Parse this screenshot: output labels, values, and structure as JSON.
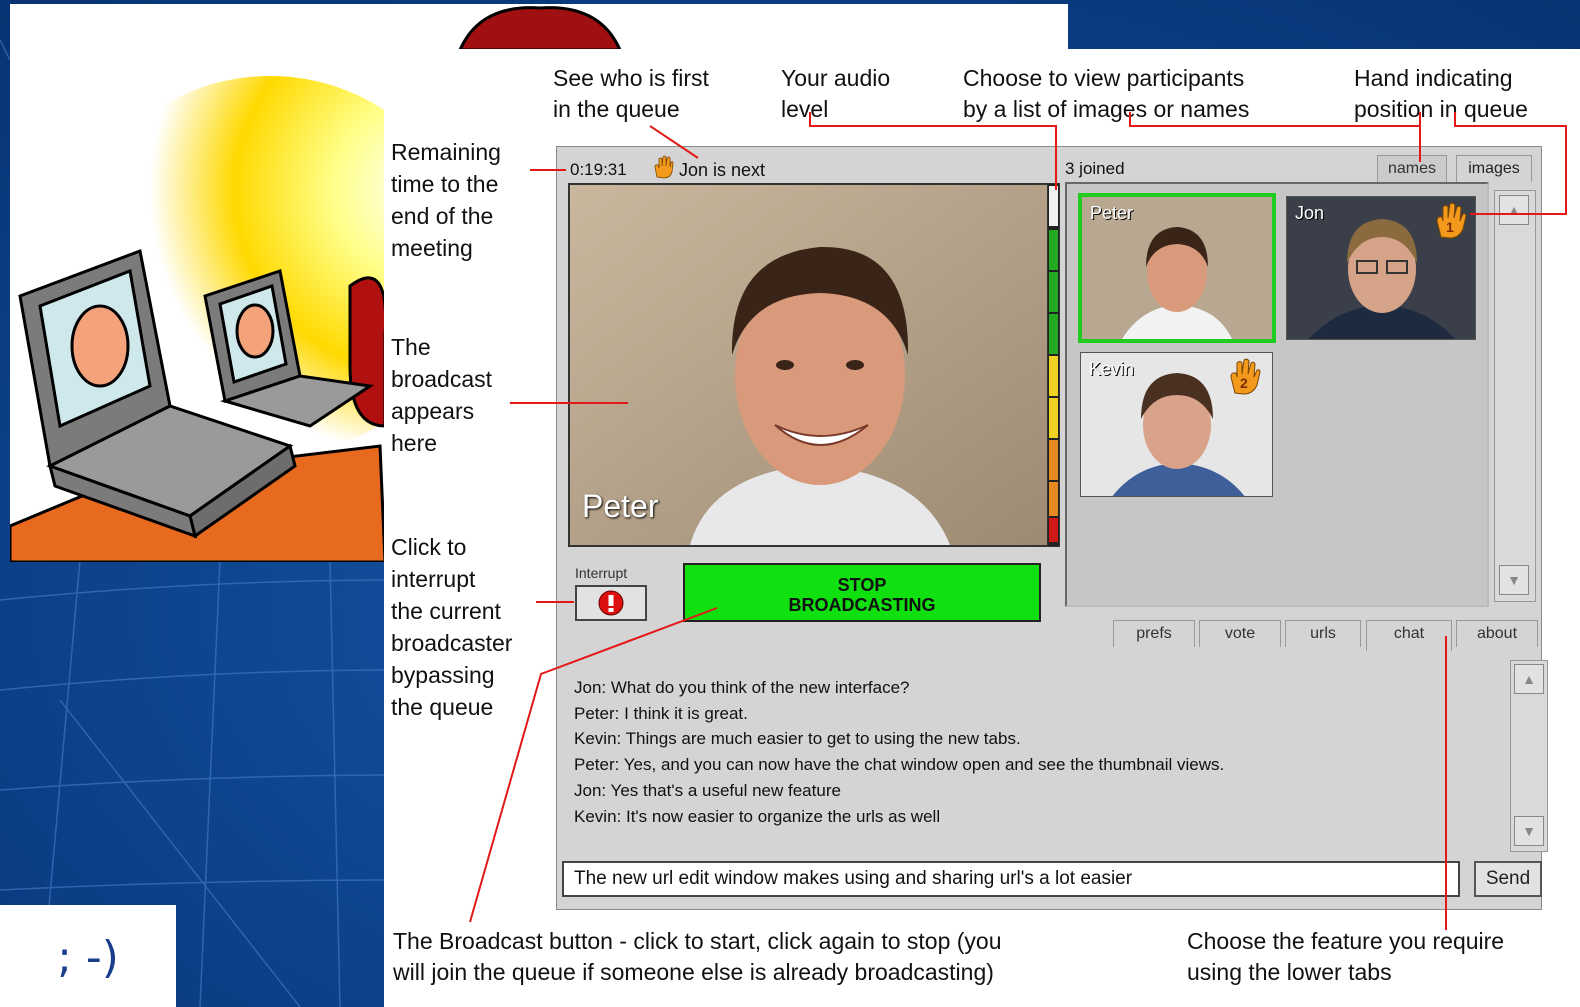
{
  "callouts": {
    "queue_first": [
      "See who is first",
      "in the queue"
    ],
    "audio_level": [
      "Your audio",
      "level"
    ],
    "view_participants": [
      "Choose to view participants",
      "by a list of images or names"
    ],
    "hand_indicating": [
      "Hand indicating",
      "position in queue"
    ],
    "remaining_time": [
      "Remaining",
      "time to the",
      "end of the",
      "meeting"
    ],
    "broadcast_appears": [
      "The",
      "broadcast",
      "appears",
      "here"
    ],
    "click_interrupt": [
      "Click to",
      "interrupt",
      "the current",
      "broadcaster",
      "bypassing",
      "the queue"
    ],
    "broadcast_button": [
      "The Broadcast button - click to start, click again to stop (you",
      "will join the queue if someone else is already broadcasting)"
    ],
    "choose_feature": [
      "Choose the feature you require",
      "using the lower tabs"
    ]
  },
  "wink": "; -)",
  "app": {
    "timer": "0:19:31",
    "next_text": "Jon is next",
    "joined": "3 joined",
    "upper_tabs": [
      "names",
      "images"
    ],
    "active_upper_tab": "images",
    "broadcaster_name": "Peter",
    "interrupt_label": "Interrupt",
    "stop_button": [
      "STOP",
      "BROADCASTING"
    ],
    "participants": [
      {
        "name": "Peter",
        "queue": ""
      },
      {
        "name": "Jon",
        "queue": "1"
      },
      {
        "name": "Kevin",
        "queue": "2"
      }
    ],
    "lower_tabs": [
      "prefs",
      "vote",
      "urls",
      "chat",
      "about"
    ],
    "active_lower_tab": "chat",
    "chat_messages": [
      "Jon: What do you think of the new interface?",
      "Peter: I think it is great.",
      "Kevin: Things are much easier to get to using the new tabs.",
      "Peter: Yes, and you can now have the chat window open and see the thumbnail views.",
      "Jon: Yes that's a useful new feature",
      "Kevin: It's now easier to organize the urls as well"
    ],
    "chat_input_value": "The new url edit window makes using and sharing url's a lot easier",
    "send_label": "Send"
  },
  "colors": {
    "background": "#0b3f86",
    "broadcast_button": "#10e010",
    "selected_thumb": "#1fcc1f",
    "callout_line": "#e31818",
    "hand": "#f39a1c"
  },
  "meter_levels": {
    "green_segments": 4,
    "yellow_segments": 3,
    "orange_segments": 1,
    "red_segments": 1
  }
}
